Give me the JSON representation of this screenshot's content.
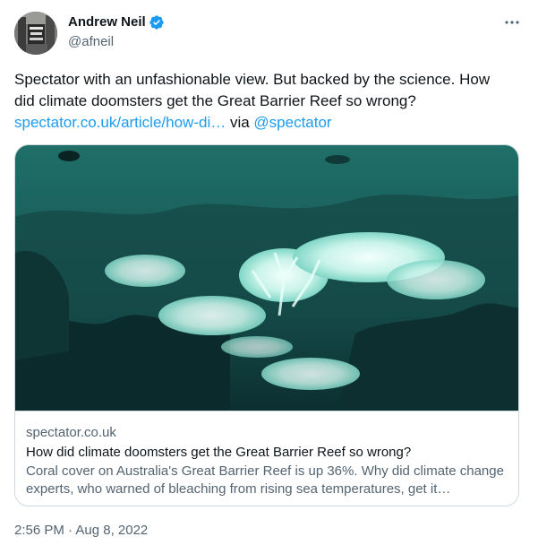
{
  "author": {
    "display_name": "Andrew Neil",
    "handle": "@afneil",
    "verified": true,
    "verified_color": "#1d9bf0",
    "avatar_icon": "profile-photo"
  },
  "more_icon": "more-options-icon",
  "tweet": {
    "text_line1": "Spectator with an unfashionable view. But backed by the science. How",
    "text_line2": "did climate doomsters get the Great Barrier Reef so wrong?",
    "link_text": "spectator.co.uk/article/how-di…",
    "via_text": " via ",
    "mention": "@spectator"
  },
  "card": {
    "domain": "spectator.co.uk",
    "title": "How did climate doomsters get the Great Barrier Reef so wrong?",
    "description": "Coral cover on Australia's Great Barrier Reef is up 36%. Why did climate change experts, who warned of bleaching from rising sea temperatures, get it…",
    "image_subject": "bleached coral reef underwater"
  },
  "timestamp": "2:56 PM · Aug 8, 2022",
  "colors": {
    "link": "#1d9bf0",
    "text_primary": "#0f1419",
    "text_secondary": "#536471",
    "border": "#cfd9de"
  }
}
